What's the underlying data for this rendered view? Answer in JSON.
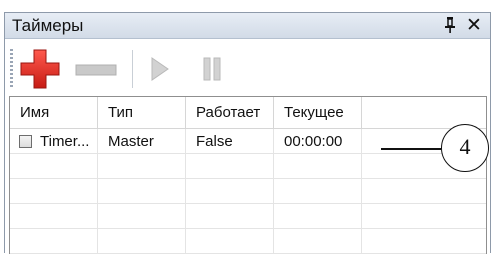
{
  "panel": {
    "title": "Таймеры",
    "pin_glyph": "ᛜ",
    "close_glyph": "✕"
  },
  "toolbar": {
    "add_icon": "plus-icon",
    "remove_icon": "minus-icon",
    "play_icon": "play-icon",
    "pause_icon": "pause-icon"
  },
  "table": {
    "columns": [
      "Имя",
      "Тип",
      "Работает",
      "Текущее"
    ],
    "rows": [
      {
        "checked": false,
        "name": "Timer...",
        "type": "Master",
        "running": "False",
        "current": "00:00:00"
      }
    ]
  },
  "callout": {
    "label": "4"
  },
  "colors": {
    "add_red": "#e3342f",
    "disabled_gray": "#c7c7c7",
    "title_gradient": "#d2dbe7"
  }
}
